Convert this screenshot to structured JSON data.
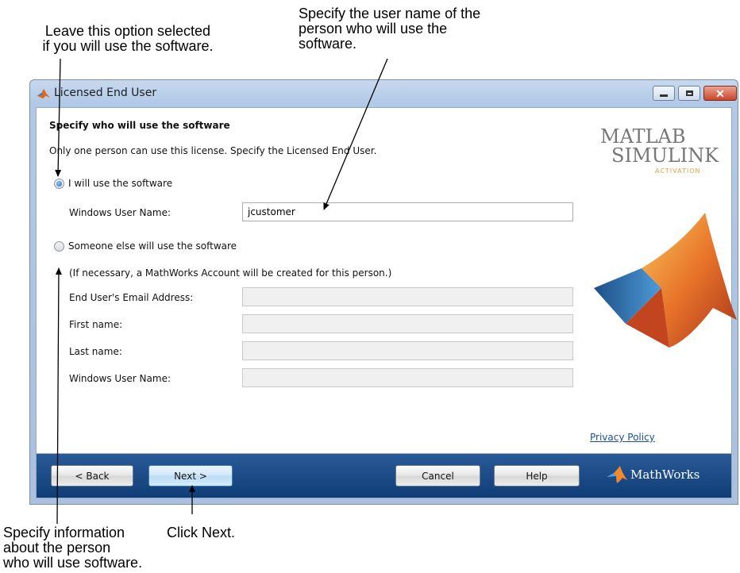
{
  "callouts": {
    "leave_selected": "Leave this option selected\nif you will use the software.",
    "specify_user": "Specify the user name of the\nperson who will use the\nsoftware.",
    "specify_info": "Specify information\nabout the person\nwho will use software.",
    "click_next": "Click Next."
  },
  "window": {
    "title": "Licensed End User",
    "controls": [
      "minimize",
      "maximize",
      "close"
    ]
  },
  "form": {
    "heading": "Specify who will use the software",
    "intro": "Only one person can use this license. Specify the Licensed End User.",
    "option_me": {
      "label": "I will use the software",
      "selected": true
    },
    "windows_user_label": "Windows User Name:",
    "windows_user_value": "jcustomer",
    "option_else": {
      "label": "Someone else will use the software",
      "selected": false
    },
    "note": "(If necessary, a MathWorks Account will be created for this person.)",
    "email_label": "End User's Email Address:",
    "first_label": "First name:",
    "last_label": "Last name:",
    "windows_user2_label": "Windows User Name:"
  },
  "branding": {
    "line1": "MATLAB",
    "line2": "SIMULINK",
    "sub": "ACTIVATION",
    "company": "MathWorks",
    "accent": "#e8a040",
    "footer_color": "#123f78"
  },
  "privacy_link": "Privacy Policy",
  "buttons": {
    "back": "< Back",
    "next": "Next >",
    "cancel": "Cancel",
    "help": "Help"
  }
}
